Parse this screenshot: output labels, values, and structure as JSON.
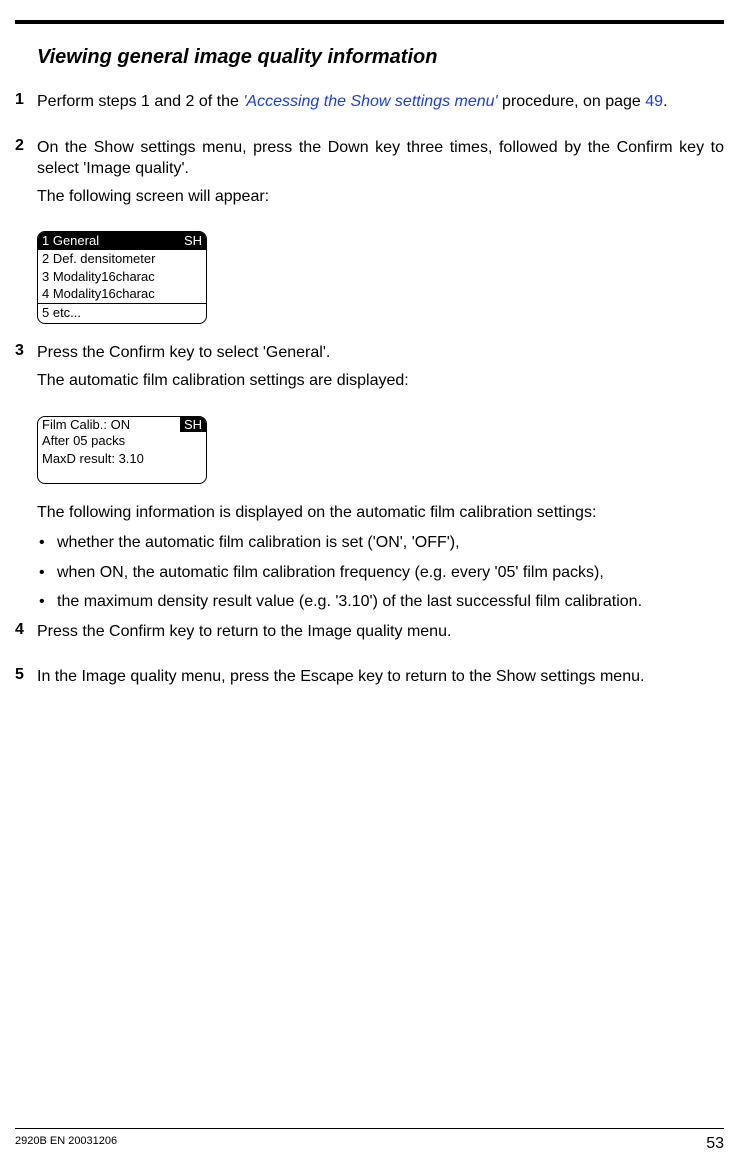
{
  "title": "Viewing general image quality information",
  "steps": {
    "s1": {
      "num": "1",
      "text_a": "Perform steps 1 and 2 of the ",
      "xref": "'Accessing the Show settings menu'",
      "text_b": " procedure, on page ",
      "page_ref": "49",
      "text_c": "."
    },
    "s2": {
      "num": "2",
      "line1": "On the Show settings menu, press the Down key three times, followed by the Confirm key to select 'Image quality'.",
      "line2": "The following screen will appear:"
    },
    "s3": {
      "num": "3",
      "line1": "Press the Confirm key to select 'General'.",
      "line2": "The automatic film calibration settings are displayed:",
      "line3": "The following information is displayed on the automatic film calibration settings:",
      "bullets": [
        "whether the automatic film calibration is set ('ON', 'OFF'),",
        "when ON, the automatic film calibration frequency (e.g. every '05' film packs),",
        "the maximum density result value (e.g. '3.10') of the last successful film calibration."
      ]
    },
    "s4": {
      "num": "4",
      "line1": "Press the Confirm key to return to the Image quality menu."
    },
    "s5": {
      "num": "5",
      "line1": "In the Image quality menu, press the Escape key to return to the Show settings menu."
    }
  },
  "screen1": {
    "tag": "SH",
    "rows": [
      "1 General",
      "2 Def. densitometer",
      "3 Modality16charac",
      "4 Modality16charac",
      "5 etc..."
    ]
  },
  "screen2": {
    "tag": "SH",
    "rows": [
      "Film Calib.: ON",
      "After 05 packs",
      "MaxD result: 3.10"
    ]
  },
  "footer": {
    "docnum": "2920B EN 20031206",
    "page": "53"
  }
}
